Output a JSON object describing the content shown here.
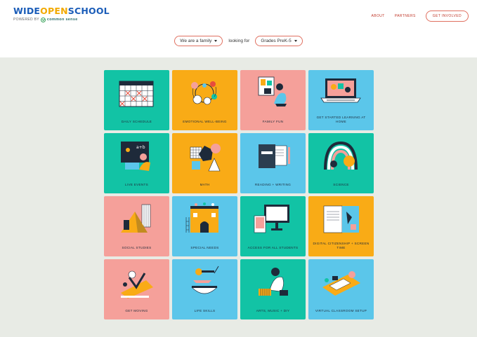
{
  "header": {
    "logo": {
      "wide": "WIDE",
      "open": "OPEN",
      "school": "SCHOOL",
      "powered_by": "POWERED BY",
      "partner": "common sense"
    },
    "nav": {
      "about": "ABOUT",
      "partners": "PARTNERS",
      "get_involved": "GET INVOLVED"
    }
  },
  "filters": {
    "audience": "We are a family",
    "connector": "looking for",
    "grade": "Grades PreK-5"
  },
  "tiles": [
    {
      "label": "DAILY SCHEDULE",
      "color": "#12c3a5",
      "icon": "calendar-icon"
    },
    {
      "label": "EMOTIONAL WELL-BEING",
      "color": "#f9ab16",
      "icon": "flowers-icon"
    },
    {
      "label": "FAMILY FUN",
      "color": "#f5a09a",
      "icon": "family-icon"
    },
    {
      "label": "GET STARTED LEARNING AT HOME",
      "color": "#5bc6ea",
      "icon": "laptop-icon"
    },
    {
      "label": "LIVE EVENTS",
      "color": "#12c3a5",
      "icon": "chalkboard-icon"
    },
    {
      "label": "MATH",
      "color": "#f9ab16",
      "icon": "shapes-icon"
    },
    {
      "label": "READING + WRITING",
      "color": "#5bc6ea",
      "icon": "book-icon"
    },
    {
      "label": "SCIENCE",
      "color": "#12c3a5",
      "icon": "rainbow-icon"
    },
    {
      "label": "SOCIAL STUDIES",
      "color": "#f5a09a",
      "icon": "pyramid-icon"
    },
    {
      "label": "SPECIAL NEEDS",
      "color": "#5bc6ea",
      "icon": "building-icon"
    },
    {
      "label": "ACCESS FOR ALL STUDENTS",
      "color": "#12c3a5",
      "icon": "monitor-icon"
    },
    {
      "label": "DIGITAL CITIZENSHIP + SCREEN TIME",
      "color": "#f9ab16",
      "icon": "newspaper-icon"
    },
    {
      "label": "GET MOVING",
      "color": "#f5a09a",
      "icon": "exercise-icon"
    },
    {
      "label": "LIFE SKILLS",
      "color": "#5bc6ea",
      "icon": "cooking-icon"
    },
    {
      "label": "ARTS, MUSIC + DIY",
      "color": "#12c3a5",
      "icon": "art-icon"
    },
    {
      "label": "VIRTUAL CLASSROOM SETUP",
      "color": "#5bc6ea",
      "icon": "desk-icon"
    }
  ]
}
